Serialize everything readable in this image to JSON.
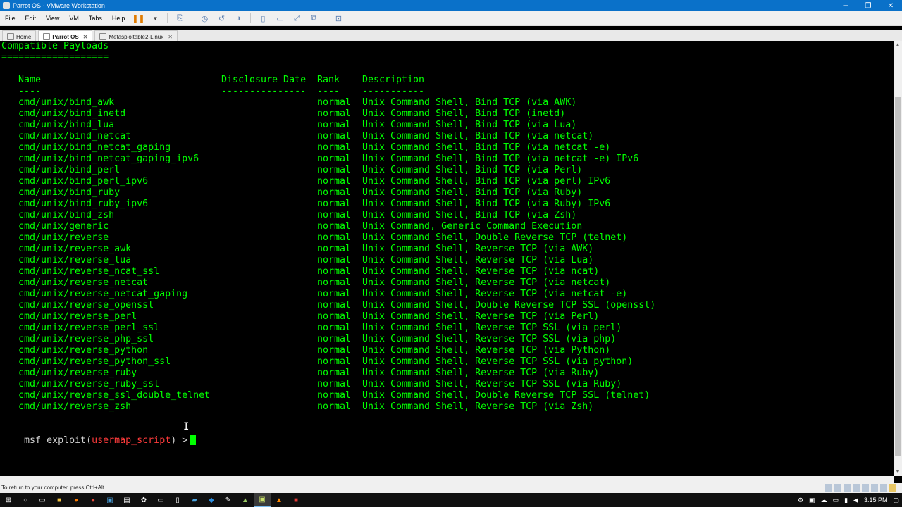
{
  "window": {
    "title": "Parrot OS - VMware Workstation",
    "minimize": "─",
    "maximize": "❐",
    "close": "✕"
  },
  "menu": {
    "items": [
      "File",
      "Edit",
      "View",
      "VM",
      "Tabs",
      "Help"
    ]
  },
  "tabs": [
    {
      "label": "Home",
      "active": false
    },
    {
      "label": "Parrot OS",
      "active": true,
      "close": "✕"
    },
    {
      "label": "Metasploitable2-Linux",
      "active": false,
      "close": "✕"
    }
  ],
  "terminal": {
    "section_title": "Compatible Payloads",
    "section_underline": "===================",
    "headers": {
      "name": "Name",
      "date": "Disclosure Date",
      "rank": "Rank",
      "description": "Description"
    },
    "header_rules": {
      "name": "----",
      "date": "---------------",
      "rank": "----",
      "description": "-----------"
    },
    "rows": [
      {
        "name": "cmd/unix/bind_awk",
        "rank": "normal",
        "description": "Unix Command Shell, Bind TCP (via AWK)"
      },
      {
        "name": "cmd/unix/bind_inetd",
        "rank": "normal",
        "description": "Unix Command Shell, Bind TCP (inetd)"
      },
      {
        "name": "cmd/unix/bind_lua",
        "rank": "normal",
        "description": "Unix Command Shell, Bind TCP (via Lua)"
      },
      {
        "name": "cmd/unix/bind_netcat",
        "rank": "normal",
        "description": "Unix Command Shell, Bind TCP (via netcat)"
      },
      {
        "name": "cmd/unix/bind_netcat_gaping",
        "rank": "normal",
        "description": "Unix Command Shell, Bind TCP (via netcat -e)"
      },
      {
        "name": "cmd/unix/bind_netcat_gaping_ipv6",
        "rank": "normal",
        "description": "Unix Command Shell, Bind TCP (via netcat -e) IPv6"
      },
      {
        "name": "cmd/unix/bind_perl",
        "rank": "normal",
        "description": "Unix Command Shell, Bind TCP (via Perl)"
      },
      {
        "name": "cmd/unix/bind_perl_ipv6",
        "rank": "normal",
        "description": "Unix Command Shell, Bind TCP (via perl) IPv6"
      },
      {
        "name": "cmd/unix/bind_ruby",
        "rank": "normal",
        "description": "Unix Command Shell, Bind TCP (via Ruby)"
      },
      {
        "name": "cmd/unix/bind_ruby_ipv6",
        "rank": "normal",
        "description": "Unix Command Shell, Bind TCP (via Ruby) IPv6"
      },
      {
        "name": "cmd/unix/bind_zsh",
        "rank": "normal",
        "description": "Unix Command Shell, Bind TCP (via Zsh)"
      },
      {
        "name": "cmd/unix/generic",
        "rank": "normal",
        "description": "Unix Command, Generic Command Execution"
      },
      {
        "name": "cmd/unix/reverse",
        "rank": "normal",
        "description": "Unix Command Shell, Double Reverse TCP (telnet)"
      },
      {
        "name": "cmd/unix/reverse_awk",
        "rank": "normal",
        "description": "Unix Command Shell, Reverse TCP (via AWK)"
      },
      {
        "name": "cmd/unix/reverse_lua",
        "rank": "normal",
        "description": "Unix Command Shell, Reverse TCP (via Lua)"
      },
      {
        "name": "cmd/unix/reverse_ncat_ssl",
        "rank": "normal",
        "description": "Unix Command Shell, Reverse TCP (via ncat)"
      },
      {
        "name": "cmd/unix/reverse_netcat",
        "rank": "normal",
        "description": "Unix Command Shell, Reverse TCP (via netcat)"
      },
      {
        "name": "cmd/unix/reverse_netcat_gaping",
        "rank": "normal",
        "description": "Unix Command Shell, Reverse TCP (via netcat -e)"
      },
      {
        "name": "cmd/unix/reverse_openssl",
        "rank": "normal",
        "description": "Unix Command Shell, Double Reverse TCP SSL (openssl)"
      },
      {
        "name": "cmd/unix/reverse_perl",
        "rank": "normal",
        "description": "Unix Command Shell, Reverse TCP (via Perl)"
      },
      {
        "name": "cmd/unix/reverse_perl_ssl",
        "rank": "normal",
        "description": "Unix Command Shell, Reverse TCP SSL (via perl)"
      },
      {
        "name": "cmd/unix/reverse_php_ssl",
        "rank": "normal",
        "description": "Unix Command Shell, Reverse TCP SSL (via php)"
      },
      {
        "name": "cmd/unix/reverse_python",
        "rank": "normal",
        "description": "Unix Command Shell, Reverse TCP (via Python)"
      },
      {
        "name": "cmd/unix/reverse_python_ssl",
        "rank": "normal",
        "description": "Unix Command Shell, Reverse TCP SSL (via python)"
      },
      {
        "name": "cmd/unix/reverse_ruby",
        "rank": "normal",
        "description": "Unix Command Shell, Reverse TCP (via Ruby)"
      },
      {
        "name": "cmd/unix/reverse_ruby_ssl",
        "rank": "normal",
        "description": "Unix Command Shell, Reverse TCP SSL (via Ruby)"
      },
      {
        "name": "cmd/unix/reverse_ssl_double_telnet",
        "rank": "normal",
        "description": "Unix Command Shell, Double Reverse TCP SSL (telnet)"
      },
      {
        "name": "cmd/unix/reverse_zsh",
        "rank": "normal",
        "description": "Unix Command Shell, Reverse TCP (via Zsh)"
      }
    ],
    "prompt": {
      "msf": "msf",
      "exploit": "exploit(",
      "module": "usermap_script",
      "close": ") >"
    }
  },
  "statusbar": {
    "hint": "To return to your computer, press Ctrl+Alt."
  },
  "taskbar": {
    "time": "3:15 PM"
  },
  "colors": {
    "terminal_fg": "#00ff00",
    "terminal_bg": "#000000",
    "module_red": "#ff3b3b",
    "titlebar_blue": "#0a71c9"
  }
}
